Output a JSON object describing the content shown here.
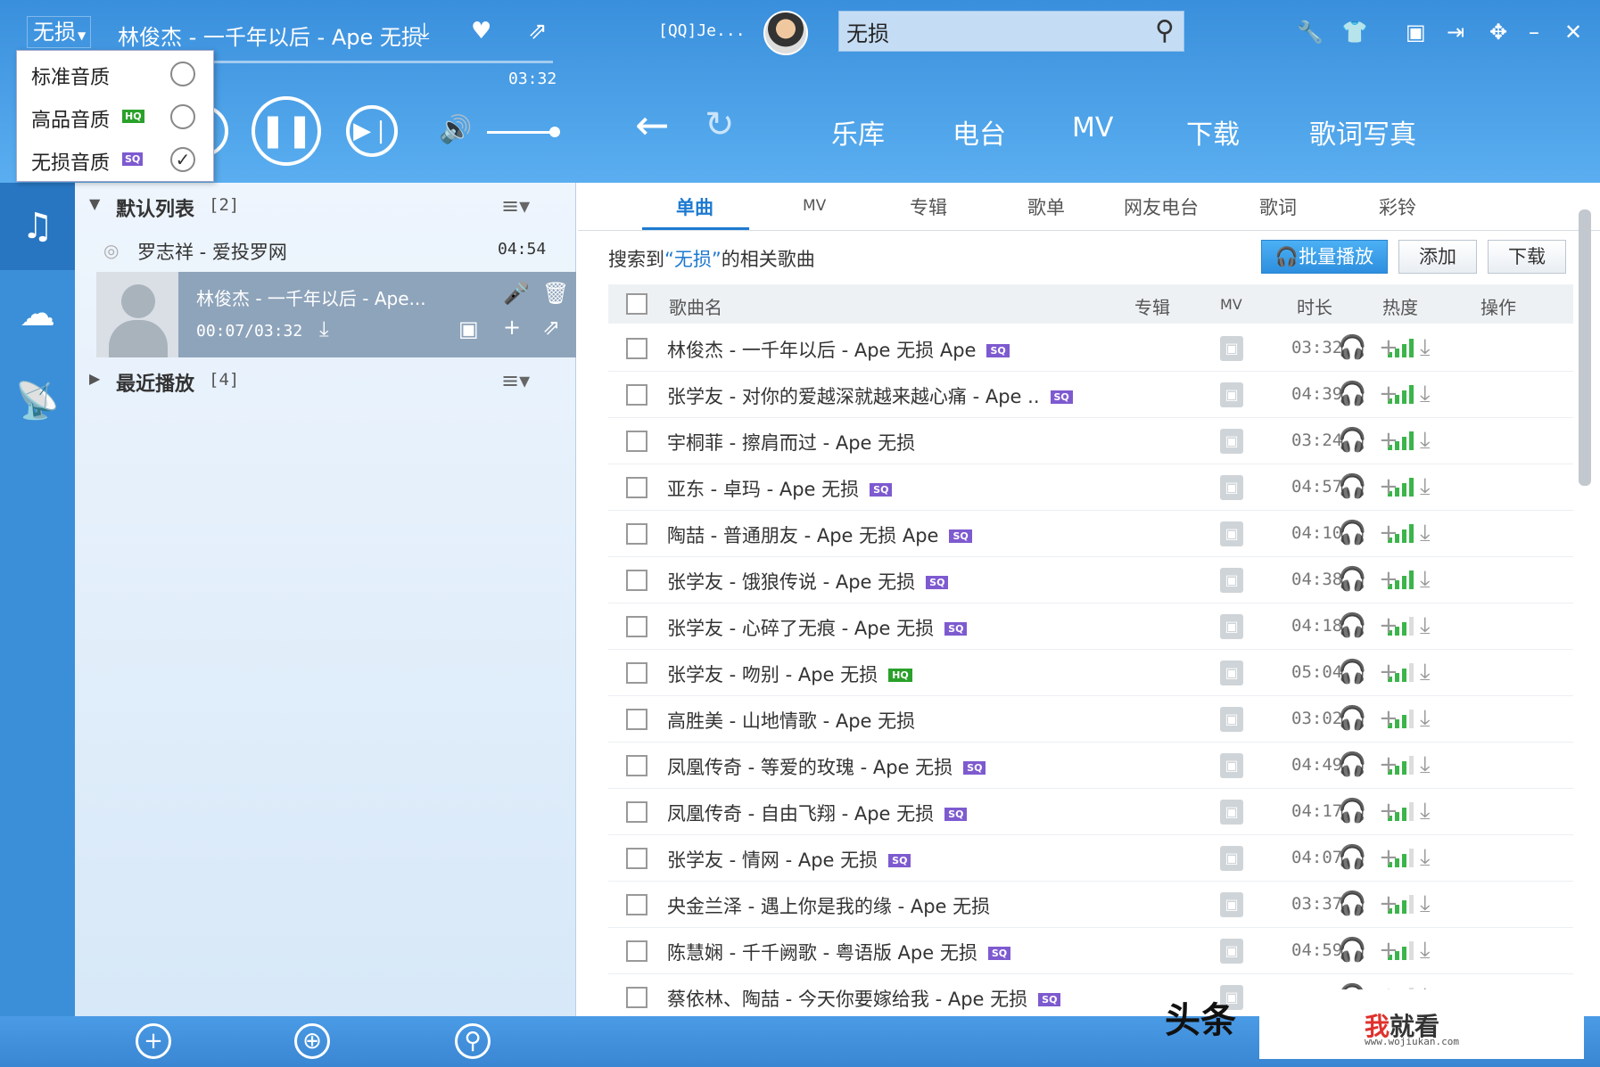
{
  "titlebar": {
    "quality_label": "无损",
    "now_playing": "林俊杰 - 一千年以后 - Ape 无损",
    "qq_user": "[QQ]Je...",
    "search_value": "无损",
    "time_total": "03:32"
  },
  "quality_menu": [
    {
      "label": "标准音质",
      "badge": "",
      "checked": false
    },
    {
      "label": "高品音质",
      "badge": "HQ",
      "checked": false
    },
    {
      "label": "无损音质",
      "badge": "SQ",
      "checked": true
    }
  ],
  "main_nav": [
    "乐库",
    "电台",
    "MV",
    "下载",
    "歌词写真"
  ],
  "playlist": {
    "default_group": {
      "name": "默认列表",
      "count": "[2]"
    },
    "song": {
      "title": "罗志祥 - 爱投罗网",
      "duration": "04:54"
    },
    "playing": {
      "title": "林俊杰 - 一千年以后 - Ape...",
      "progress": "00:07/03:32"
    },
    "recent_group": {
      "name": "最近播放",
      "count": "[4]"
    }
  },
  "tabs": [
    "单曲",
    "MV",
    "专辑",
    "歌单",
    "网友电台",
    "歌词",
    "彩铃"
  ],
  "search_info": {
    "prefix": "搜索到",
    "keyword": "“无损”",
    "suffix": "的相关歌曲"
  },
  "buttons": {
    "play_all": "批量播放",
    "add": "添加",
    "download": "下载"
  },
  "table_headers": {
    "name": "歌曲名",
    "album": "专辑",
    "mv": "MV",
    "duration": "时长",
    "hot": "热度",
    "ops": "操作"
  },
  "songs": [
    {
      "name": "林俊杰 - 一千年以后 - Ape 无损 Ape",
      "badge": "SQ",
      "duration": "03:32",
      "hot": 4
    },
    {
      "name": "张学友 - 对你的爱越深就越来越心痛 - Ape ..",
      "badge": "SQ",
      "duration": "04:39",
      "hot": 4
    },
    {
      "name": "宇桐菲 - 擦肩而过 - Ape 无损",
      "badge": "",
      "duration": "03:24",
      "hot": 4
    },
    {
      "name": "亚东 - 卓玛 - Ape 无损",
      "badge": "SQ",
      "duration": "04:57",
      "hot": 4
    },
    {
      "name": "陶喆 - 普通朋友 - Ape 无损 Ape",
      "badge": "SQ",
      "duration": "04:10",
      "hot": 4
    },
    {
      "name": "张学友 - 饿狼传说 - Ape 无损",
      "badge": "SQ",
      "duration": "04:38",
      "hot": 4
    },
    {
      "name": "张学友 - 心碎了无痕 - Ape 无损",
      "badge": "SQ",
      "duration": "04:18",
      "hot": 3
    },
    {
      "name": "张学友 - 吻别 - Ape 无损",
      "badge": "HQ",
      "duration": "05:04",
      "hot": 3
    },
    {
      "name": "高胜美 - 山地情歌 - Ape 无损",
      "badge": "",
      "duration": "03:02",
      "hot": 3
    },
    {
      "name": "凤凰传奇 - 等爱的玫瑰 - Ape 无损",
      "badge": "SQ",
      "duration": "04:49",
      "hot": 3
    },
    {
      "name": "凤凰传奇 - 自由飞翔 - Ape 无损",
      "badge": "SQ",
      "duration": "04:17",
      "hot": 3
    },
    {
      "name": "张学友 - 情网 - Ape 无损",
      "badge": "SQ",
      "duration": "04:07",
      "hot": 3
    },
    {
      "name": "央金兰泽 - 遇上你是我的缘 - Ape 无损",
      "badge": "",
      "duration": "03:37",
      "hot": 3
    },
    {
      "name": "陈慧娴 - 千千阙歌 - 粤语版 Ape 无损",
      "badge": "SQ",
      "duration": "04:59",
      "hot": 3
    },
    {
      "name": "蔡依林、陶喆 - 今天你要嫁给我 - Ape 无损",
      "badge": "SQ",
      "duration": "",
      "hot": 0
    }
  ],
  "watermark": {
    "left": "头条",
    "brand_red": "我",
    "brand_rest": "就看",
    "url": "www.wojiukan.com"
  },
  "colors": {
    "accent": "#1e7ad0",
    "sq_badge": "#7e5ad0",
    "hq_badge": "#2aa12a",
    "hot_on": "#3bb54a"
  }
}
